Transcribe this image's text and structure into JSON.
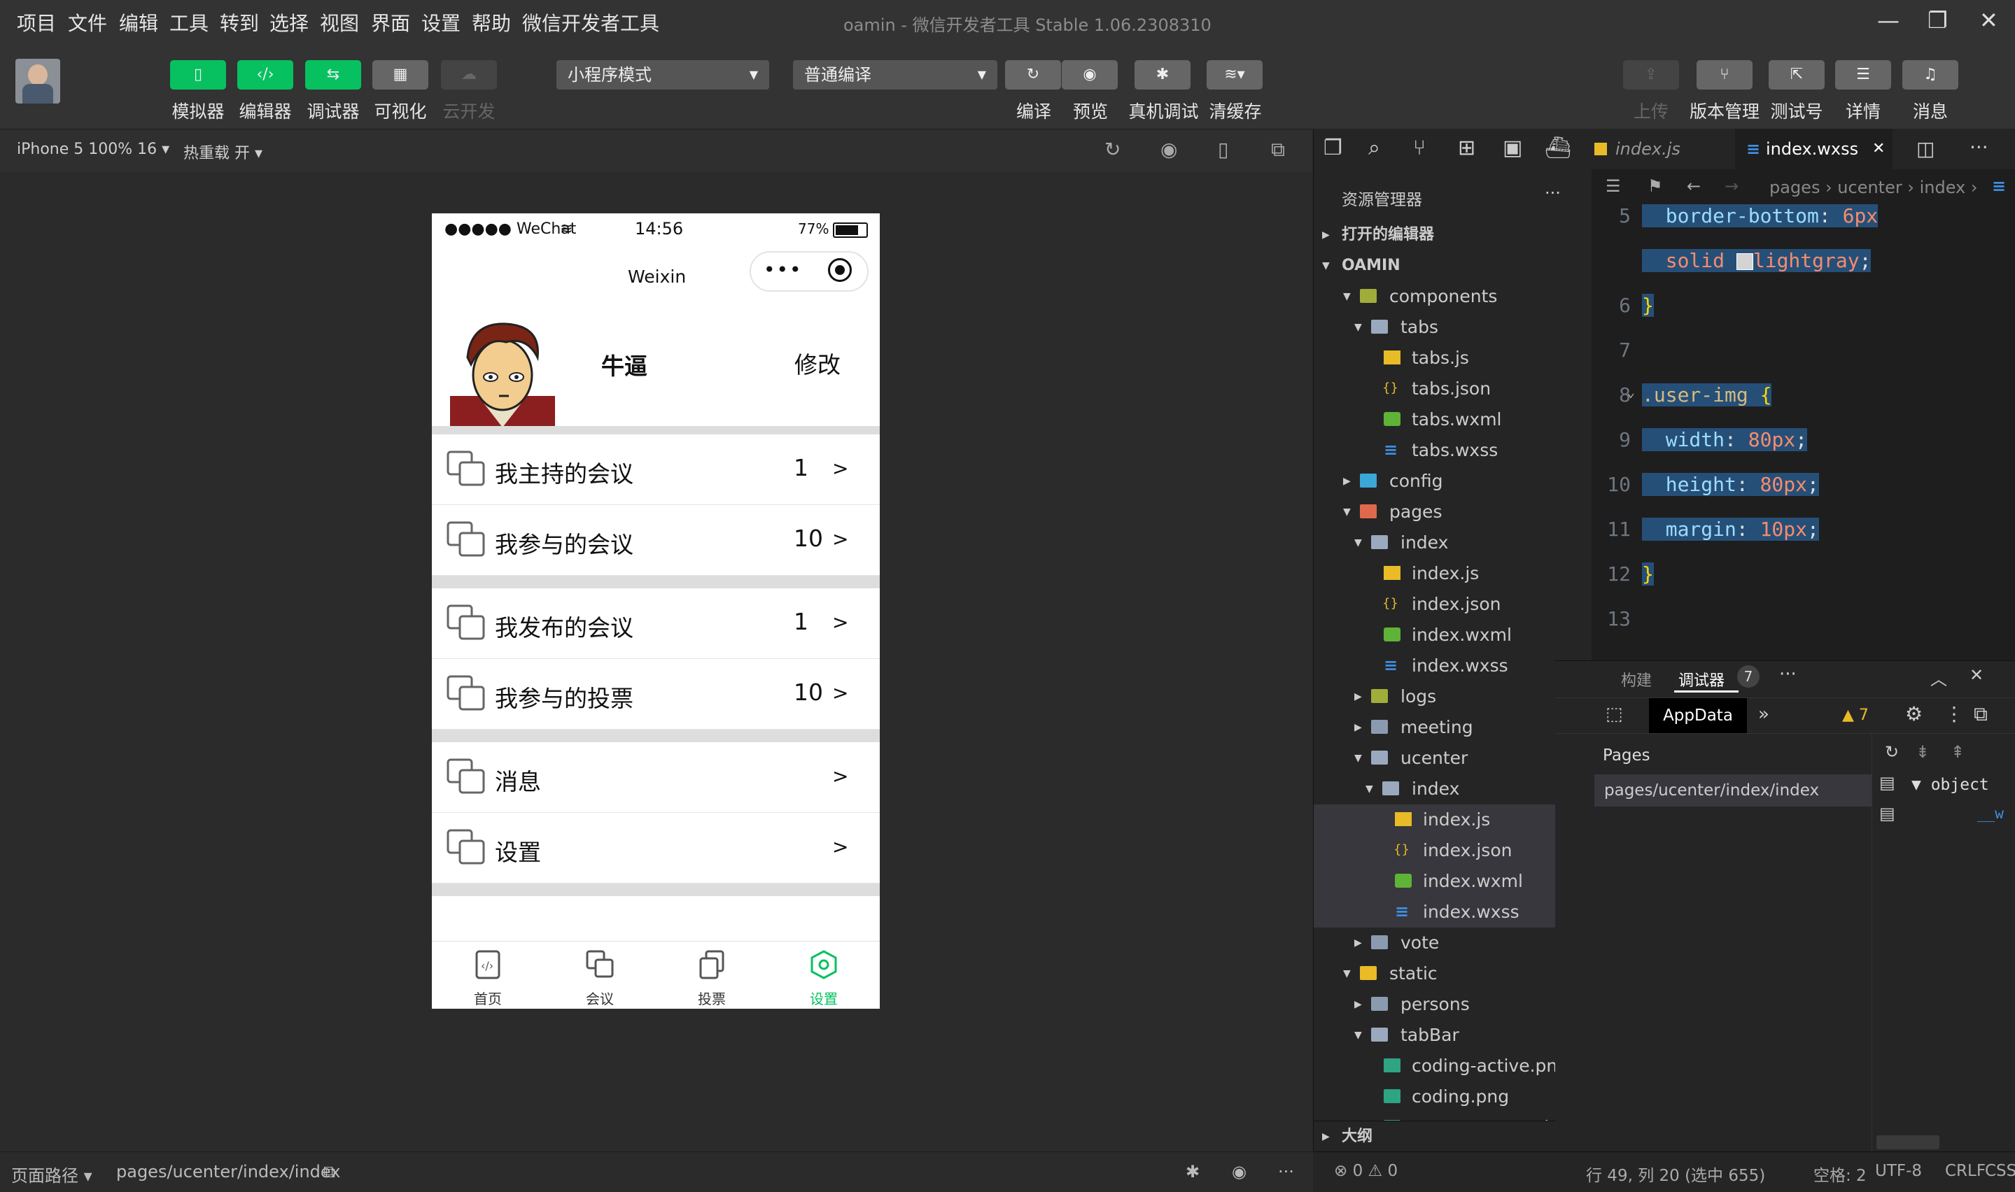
{
  "menu": [
    "项目",
    "文件",
    "编辑",
    "工具",
    "转到",
    "选择",
    "视图",
    "界面",
    "设置",
    "帮助",
    "微信开发者工具"
  ],
  "window_title": "oamin - 微信开发者工具 Stable 1.06.2308310",
  "toolbar": {
    "left_buttons": [
      "模拟器",
      "编辑器",
      "调试器",
      "可视化",
      "云开发"
    ],
    "mode_select": "小程序模式",
    "compile_select": "普通编译",
    "mid_buttons": [
      "编译",
      "预览",
      "真机调试",
      "清缓存"
    ],
    "right_buttons": [
      "上传",
      "版本管理",
      "测试号",
      "详情",
      "消息"
    ]
  },
  "subbar": {
    "device": "iPhone 5 100% 16 ▾",
    "hot_reload": "热重载 开 ▾"
  },
  "phone": {
    "signal": "●●●●● WeChat",
    "time": "14:56",
    "battery": "77%",
    "nav_title": "Weixin",
    "user_name": "牛逼",
    "edit_label": "修改",
    "rows": [
      {
        "label": "我主持的会议",
        "count": "1",
        "arrow": ">"
      },
      {
        "label": "我参与的会议",
        "count": "10",
        "arrow": ">"
      },
      {
        "label": "我发布的会议",
        "count": "1",
        "arrow": ">"
      },
      {
        "label": "我参与的投票",
        "count": "10",
        "arrow": ">"
      },
      {
        "label": "消息",
        "count": "",
        "arrow": ">"
      },
      {
        "label": "设置",
        "count": "",
        "arrow": ">"
      }
    ],
    "tabs": [
      "首页",
      "会议",
      "投票",
      "设置"
    ],
    "active_tab_color": "#07c160"
  },
  "bottom": {
    "path_label": "页面路径 ▾",
    "path": "pages/ucenter/index/index"
  },
  "explorer": {
    "title": "资源管理器",
    "open_editors": "打开的编辑器",
    "project": "OAMIN",
    "outline": "大纲",
    "tree": [
      "components",
      "tabs",
      "tabs.js",
      "tabs.json",
      "tabs.wxml",
      "tabs.wxss",
      "config",
      "pages",
      "index",
      "index.js",
      "index.json",
      "index.wxml",
      "index.wxss",
      "logs",
      "meeting",
      "ucenter",
      "index",
      "index.js",
      "index.json",
      "index.wxml",
      "index.wxss",
      "vote",
      "static",
      "persons",
      "tabBar",
      "coding-active.png",
      "coding.png",
      "component-active.p"
    ]
  },
  "editor": {
    "tab1": "index.js",
    "tab2": "index.wxss",
    "breadcrumb": "pages › ucenter › index ›",
    "lines": [
      {
        "n": "5",
        "code": "  border-bottom: 6px"
      },
      {
        "n": "",
        "code": "  solid  lightgray;"
      },
      {
        "n": "6",
        "code": "}"
      },
      {
        "n": "7",
        "code": ""
      },
      {
        "n": "8",
        "code": ".user-img {"
      },
      {
        "n": "9",
        "code": "  width: 80px;"
      },
      {
        "n": "10",
        "code": "  height: 80px;"
      },
      {
        "n": "11",
        "code": "  margin: 10px;"
      },
      {
        "n": "12",
        "code": "}"
      },
      {
        "n": "13",
        "code": ""
      }
    ]
  },
  "devtools": {
    "tab_build": "构建",
    "tab_debugger": "调试器",
    "badge": "7",
    "appdata": "AppData",
    "warn": "▲ 7",
    "pages_header": "Pages",
    "page_path": "pages/ucenter/index/index",
    "object_label": "▼ object",
    "object_child": "__w"
  },
  "statusbar": {
    "errors": "⊗ 0 ⚠ 0",
    "position": "行 49, 列 20 (选中 655)",
    "spaces": "空格: 2",
    "encoding": "UTF-8",
    "eol": "CRLF",
    "lang": "CSS"
  }
}
